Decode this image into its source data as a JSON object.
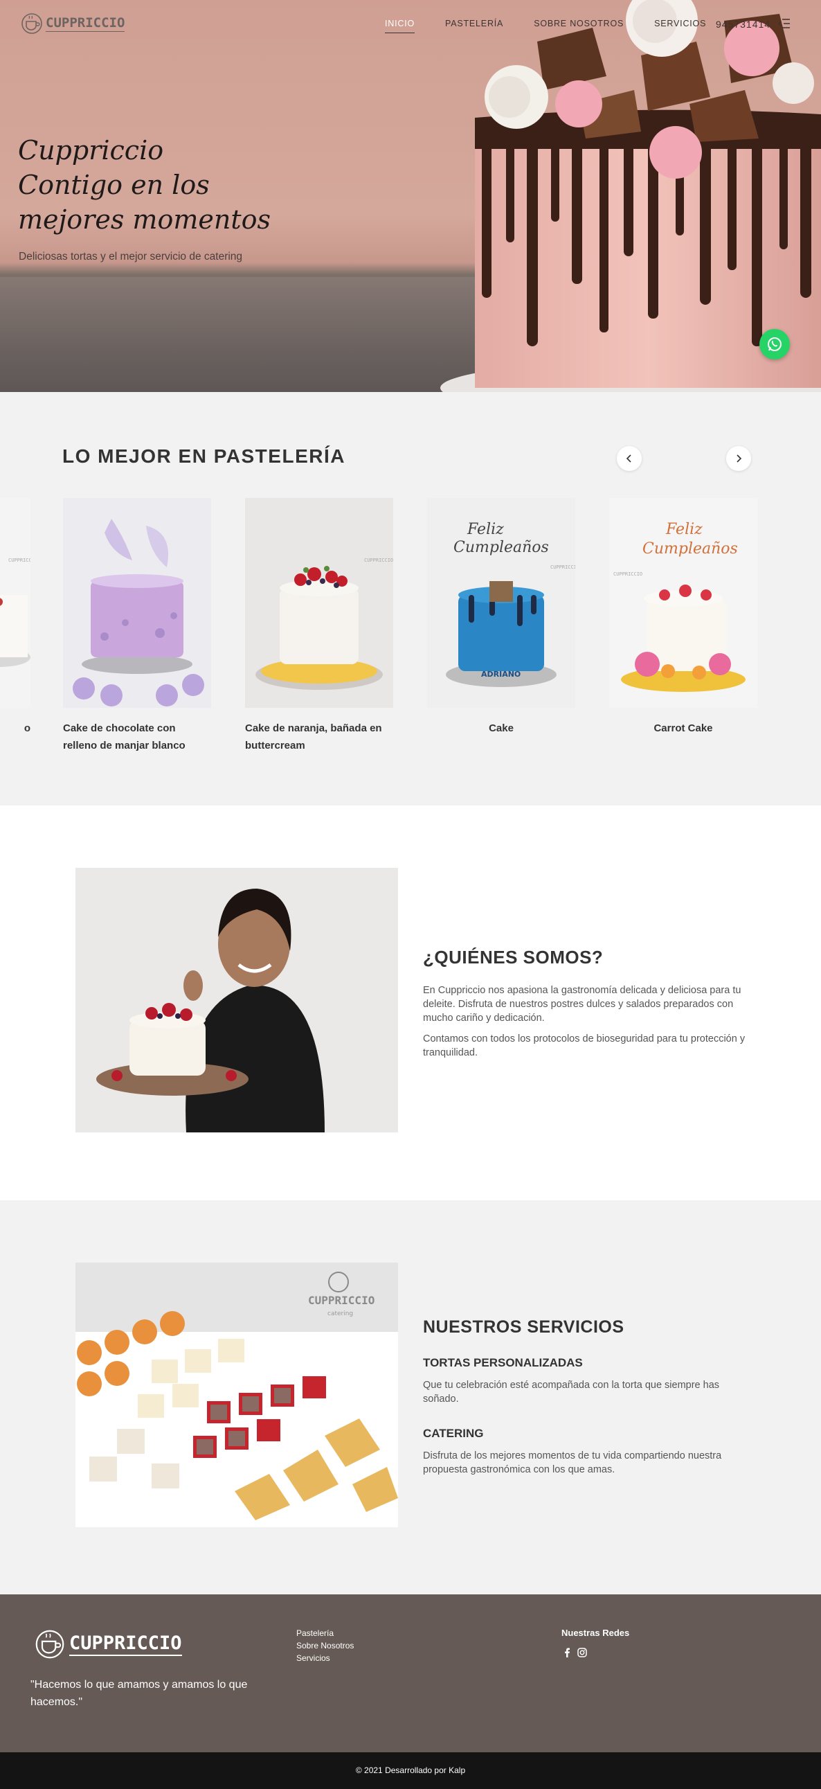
{
  "brand": {
    "name": "CUPPRICCIO"
  },
  "nav": {
    "items": [
      {
        "label": "INICIO",
        "active": true
      },
      {
        "label": "PASTELERÍA",
        "active": false
      },
      {
        "label": "SOBRE NOSOTROS",
        "active": false
      },
      {
        "label": "SERVICIOS",
        "active": false
      }
    ],
    "phone": "945731414",
    "menu_icon": "menu-icon"
  },
  "hero": {
    "title_lines": [
      "Cuppriccio",
      "Contigo en los",
      "mejores momentos"
    ],
    "subtitle": "Deliciosas tortas y el mejor servicio de catering",
    "whatsapp_icon": "whatsapp-icon"
  },
  "pasteleria": {
    "title": "LO MEJOR EN PASTELERÍA",
    "products": [
      {
        "name": "Cake de chocolate con relleno de manjar blanco"
      },
      {
        "name": "Cake de naranja, bañada en buttercream"
      },
      {
        "name": "Cake"
      },
      {
        "name": "Carrot Cake"
      }
    ],
    "partial_card_caption": "o",
    "card_watermark": "CUPPRICCIO",
    "topper_text": [
      "Feliz",
      "Cumpleaños"
    ],
    "cake_plate_text": "ADRIANO"
  },
  "quienes": {
    "title": "¿QUIÉNES SOMOS?",
    "paragraphs": [
      "En Cuppriccio nos apasiona la gastronomía delicada y deliciosa para tu deleite. Disfruta de nuestros postres dulces y salados preparados con mucho cariño y dedicación.",
      "Contamos con todos los protocolos de bioseguridad para tu protección y tranquilidad."
    ]
  },
  "servicios": {
    "title": "NUESTROS SERVICIOS",
    "photo_watermark": {
      "brand": "CUPPRICCIO",
      "tag": "catering"
    },
    "items": [
      {
        "title": "TORTAS PERSONALIZADAS",
        "text": "Que tu celebración esté acompañada con la torta que siempre has soñado."
      },
      {
        "title": "CATERING",
        "text": "Disfruta de los mejores momentos de tu vida compartiendo nuestra propuesta gastronómica con los que amas."
      }
    ]
  },
  "footer": {
    "quote": "\"Hacemos lo que amamos y amamos lo que hacemos.\"",
    "links": [
      "Pastelería",
      "Sobre Nosotros",
      "Servicios"
    ],
    "social_title": "Nuestras Redes",
    "social_icons": [
      "facebook-icon",
      "instagram-icon"
    ],
    "copyright": "© 2021 Desarrollado por Kalp"
  },
  "colors": {
    "hero_bg": "#d5a89c",
    "section_gray": "#f2f2f2",
    "footer_bg": "#655a55",
    "copyright_bg": "#141414",
    "whatsapp": "#25d366"
  }
}
